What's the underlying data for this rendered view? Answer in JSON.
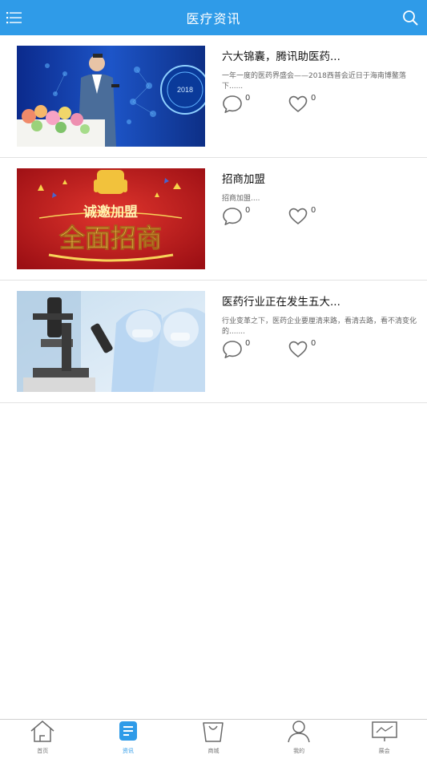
{
  "header": {
    "title": "医疗资讯",
    "menu_icon": "list-menu-icon",
    "search_icon": "search-icon",
    "bg_color": "#2f9be8"
  },
  "articles": [
    {
      "title": "六大锦囊，腾讯助医药...",
      "desc": "一年一度的医药界盛会——2018西普会近日于海南博鳌落下......",
      "comments": "0",
      "likes": "0",
      "thumb_text": "2018"
    },
    {
      "title": "招商加盟",
      "desc": "招商加盟....",
      "comments": "0",
      "likes": "0",
      "thumb_text_top": "诚邀加盟",
      "thumb_text_main": "全面招商"
    },
    {
      "title": "医药行业正在发生五大...",
      "desc": "行业变革之下，医药企业要厘清来路，看清去路，看不清变化的.......",
      "comments": "0",
      "likes": "0"
    }
  ],
  "tabbar": [
    {
      "label": "首页",
      "icon": "home-icon"
    },
    {
      "label": "资讯",
      "icon": "news-icon",
      "active": true
    },
    {
      "label": "商城",
      "icon": "shopping-bag-icon"
    },
    {
      "label": "我的",
      "icon": "user-icon"
    },
    {
      "label": "展会",
      "icon": "exhibition-screen-icon"
    }
  ],
  "colors": {
    "accent": "#2f9be8",
    "icon_gray": "#6a6a6a"
  }
}
